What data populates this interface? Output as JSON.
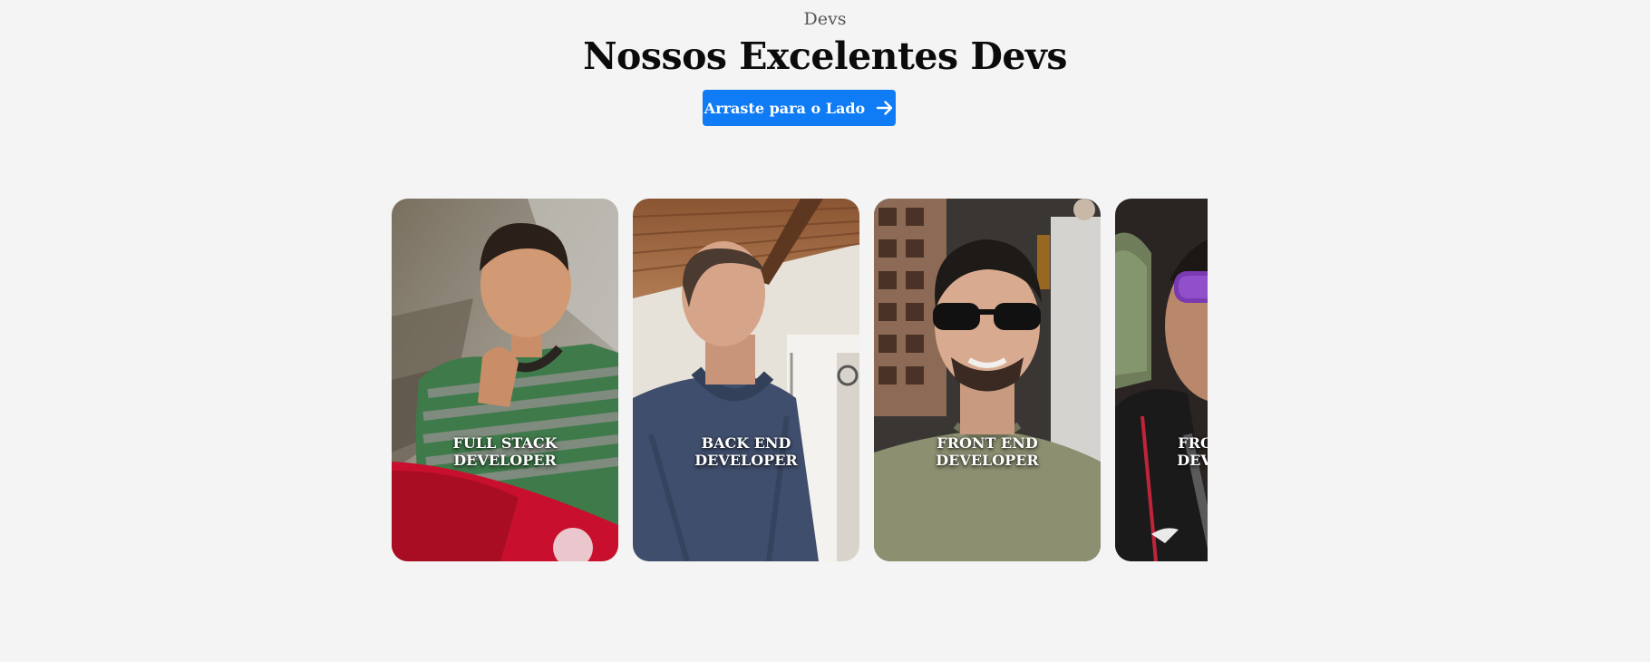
{
  "section": {
    "eyebrow": "Devs",
    "title": "Nossos Excelentes Devs",
    "cta_label": "Arraste para o Lado",
    "cta_icon": "arrow-right-icon",
    "accent_color": "#0f7bf5"
  },
  "devs": [
    {
      "role": "FULL STACK DEVELOPER"
    },
    {
      "role": "BACK END DEVELOPER"
    },
    {
      "role": "FRONT END DEVELOPER"
    },
    {
      "role": "FRONT END DEVELOPER"
    }
  ]
}
